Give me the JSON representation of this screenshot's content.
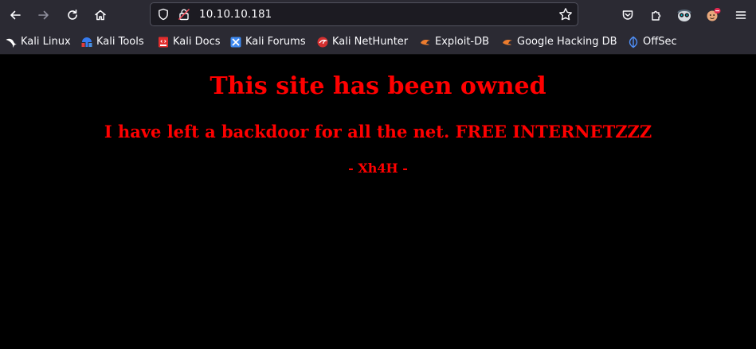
{
  "browser": {
    "url": "10.10.10.181",
    "theme": {
      "toolbar_bg": "#2b2a33",
      "urlbar_bg": "#1c1b22",
      "text": "#fbfbfe"
    },
    "nav_icons": [
      "back-arrow-icon",
      "forward-arrow-icon",
      "reload-icon",
      "home-icon"
    ],
    "toolbar_icons": [
      "pocket-icon",
      "extensions-icon",
      "profile-icon",
      "ublock-icon",
      "menu-icon"
    ],
    "bookmarks": [
      {
        "label": "Kali Linux",
        "icon": "kali-dragon-icon"
      },
      {
        "label": "Kali Tools",
        "icon": "kali-tools-icon"
      },
      {
        "label": "Kali Docs",
        "icon": "kali-docs-icon"
      },
      {
        "label": "Kali Forums",
        "icon": "kali-forums-icon"
      },
      {
        "label": "Kali NetHunter",
        "icon": "nethunter-icon"
      },
      {
        "label": "Exploit-DB",
        "icon": "exploit-db-icon"
      },
      {
        "label": "Google Hacking DB",
        "icon": "ghdb-icon"
      },
      {
        "label": "OffSec",
        "icon": "offsec-icon"
      }
    ]
  },
  "page": {
    "heading": "This site has been owned",
    "subheading": "I have left a backdoor for all the net. FREE INTERNETZZZ",
    "signature": "- Xh4H -",
    "text_color": "#ff0000",
    "background": "#000000"
  }
}
